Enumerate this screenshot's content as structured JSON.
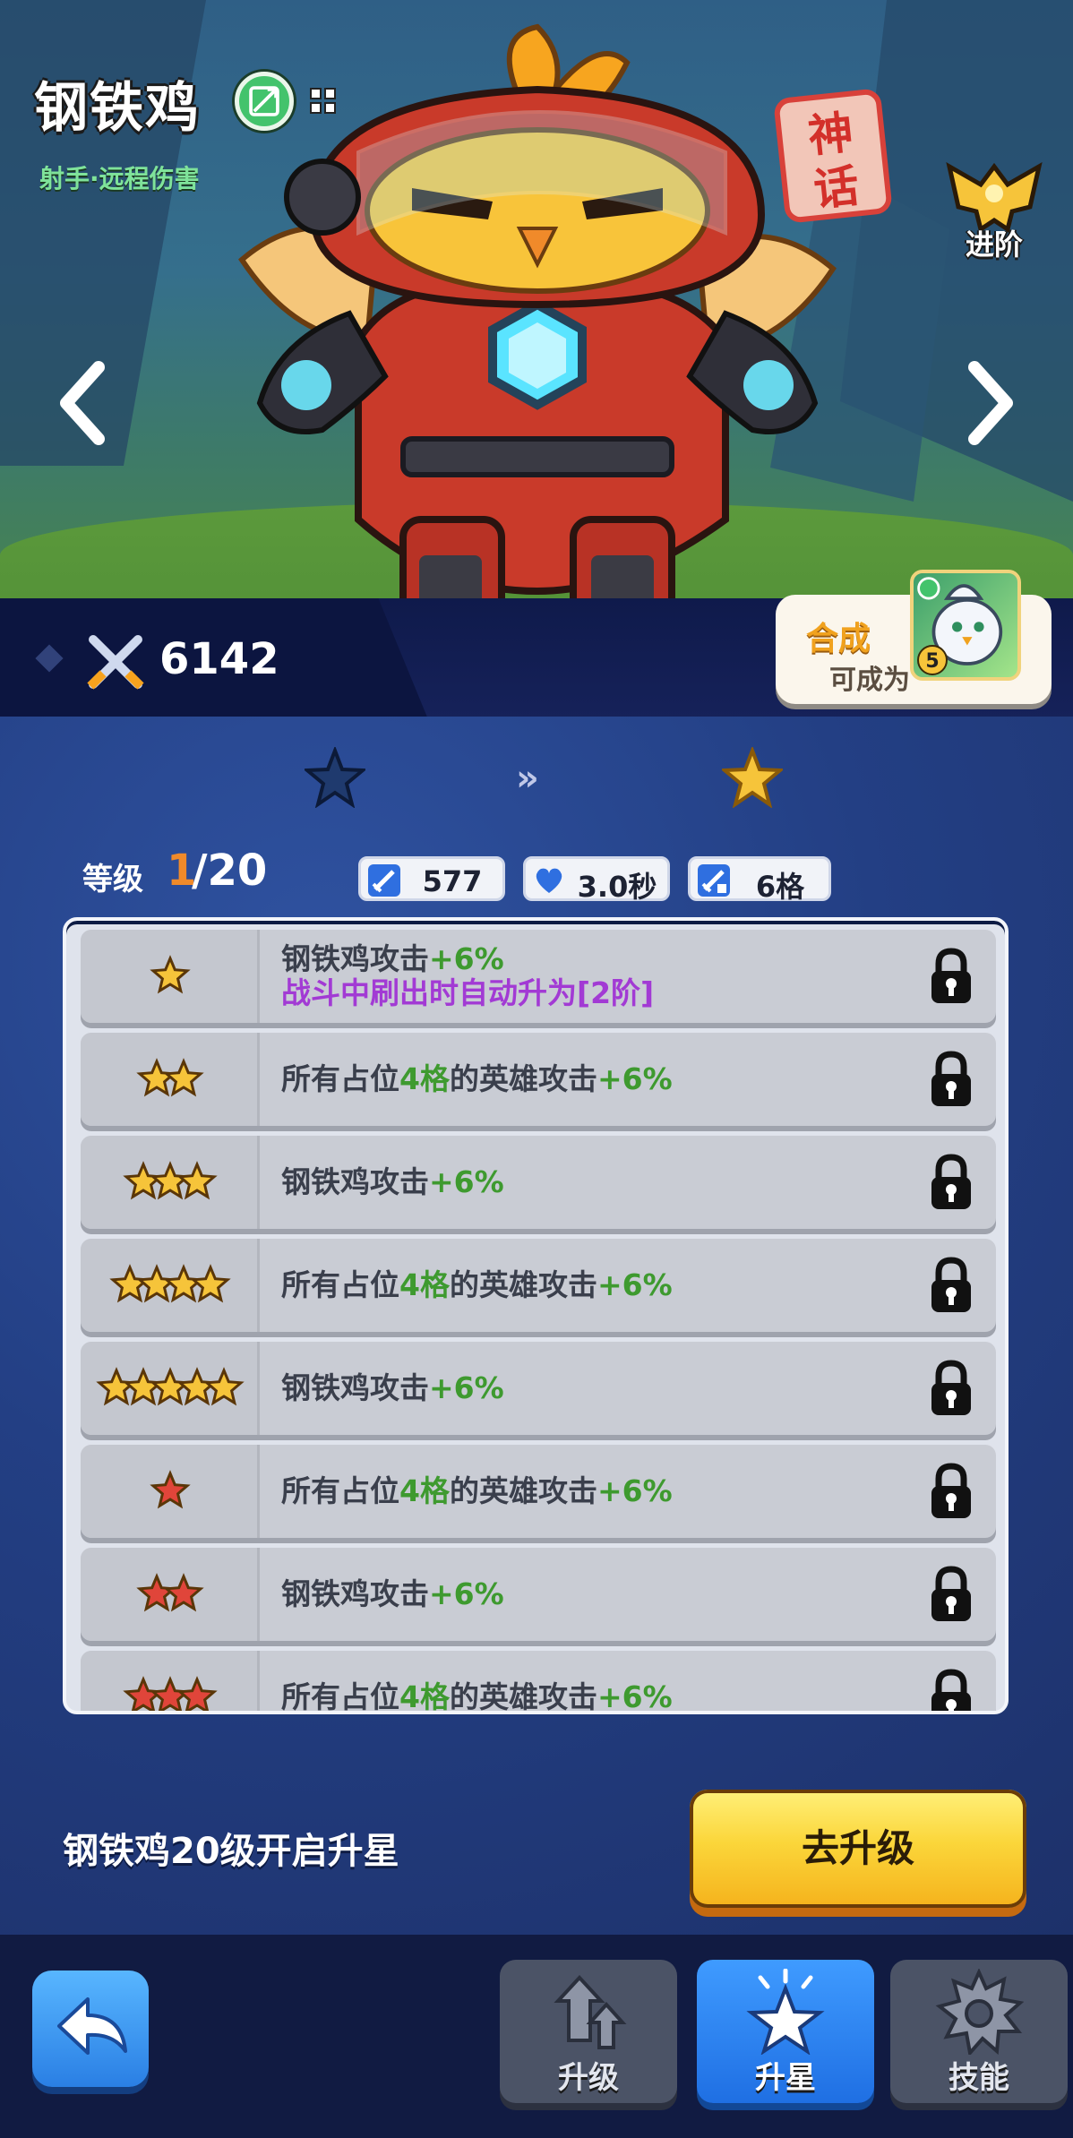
{
  "hero": {
    "name": "钢铁鸡",
    "subtitle": "射手·远程伤害",
    "rarity_chars": [
      "神",
      "话"
    ],
    "advance_label": "进阶",
    "power": "6142",
    "merge": {
      "title": "合成",
      "subtitle": "可成为",
      "result_level": "5"
    }
  },
  "star_upgrade": {
    "from_star_color": "#1f3a6e",
    "to_star_color": "#f6c43a",
    "level_label": "等级",
    "level_current": "1",
    "level_max": "/20",
    "stats": [
      {
        "icon": "sword-icon",
        "value": "577"
      },
      {
        "icon": "heart-icon",
        "value": "3.0秒"
      },
      {
        "icon": "grid-sword-icon",
        "value": "6格"
      }
    ],
    "rows": [
      {
        "stars": 1,
        "star_color": "gold",
        "parts": [
          {
            "t": "钢铁鸡攻击",
            "c": "n"
          },
          {
            "t": "+6%",
            "c": "g"
          }
        ],
        "parts2": [
          {
            "t": "战斗中刷出时自动升为[2阶]",
            "c": "p"
          }
        ]
      },
      {
        "stars": 2,
        "star_color": "gold",
        "parts": [
          {
            "t": "所有占位",
            "c": "n"
          },
          {
            "t": "4格",
            "c": "g"
          },
          {
            "t": "的英雄攻击",
            "c": "n"
          },
          {
            "t": "+6%",
            "c": "g"
          }
        ]
      },
      {
        "stars": 3,
        "star_color": "gold",
        "parts": [
          {
            "t": "钢铁鸡攻击",
            "c": "n"
          },
          {
            "t": "+6%",
            "c": "g"
          }
        ]
      },
      {
        "stars": 4,
        "star_color": "gold",
        "parts": [
          {
            "t": "所有占位",
            "c": "n"
          },
          {
            "t": "4格",
            "c": "g"
          },
          {
            "t": "的英雄攻击",
            "c": "n"
          },
          {
            "t": "+6%",
            "c": "g"
          }
        ]
      },
      {
        "stars": 5,
        "star_color": "gold",
        "parts": [
          {
            "t": "钢铁鸡攻击",
            "c": "n"
          },
          {
            "t": "+6%",
            "c": "g"
          }
        ]
      },
      {
        "stars": 1,
        "star_color": "red",
        "parts": [
          {
            "t": "所有占位",
            "c": "n"
          },
          {
            "t": "4格",
            "c": "g"
          },
          {
            "t": "的英雄攻击",
            "c": "n"
          },
          {
            "t": "+6%",
            "c": "g"
          }
        ]
      },
      {
        "stars": 2,
        "star_color": "red",
        "parts": [
          {
            "t": "钢铁鸡攻击",
            "c": "n"
          },
          {
            "t": "+6%",
            "c": "g"
          }
        ]
      },
      {
        "stars": 3,
        "star_color": "red",
        "parts": [
          {
            "t": "所有占位",
            "c": "n"
          },
          {
            "t": "4格",
            "c": "g"
          },
          {
            "t": "的英雄攻击",
            "c": "n"
          },
          {
            "t": "+6%",
            "c": "g"
          }
        ]
      }
    ],
    "requirement_text": "钢铁鸡20级开启升星",
    "upgrade_button": "去升级"
  },
  "footer": {
    "tabs": [
      {
        "label": "升级",
        "icon": "upgrade-arrow-icon",
        "active": false
      },
      {
        "label": "升星",
        "icon": "star-icon",
        "active": true
      },
      {
        "label": "技能",
        "icon": "gear-icon",
        "active": false
      }
    ]
  },
  "colors": {
    "gold_star": "#f6c43a",
    "red_star": "#e0453a",
    "bonus_green": "#3e9a2f",
    "special_purple": "#a23ad4",
    "level_orange": "#f08a2a"
  }
}
